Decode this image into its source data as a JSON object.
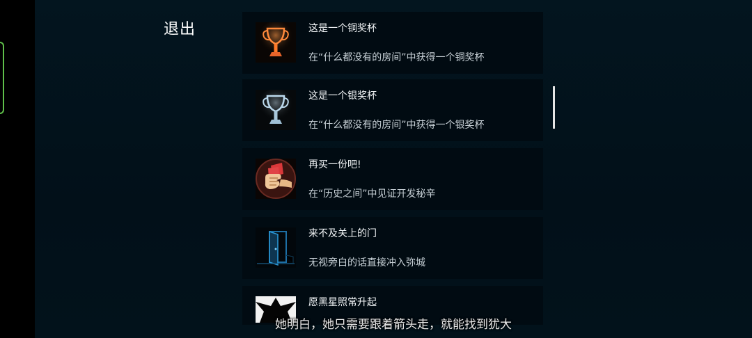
{
  "header": {
    "exit_label": "退出"
  },
  "achievements": [
    {
      "icon": "bronze-trophy-icon",
      "title": "这是一个铜奖杯",
      "desc": "在“什么都没有的房间”中获得一个铜奖杯"
    },
    {
      "icon": "silver-trophy-icon",
      "title": "这是一个银奖杯",
      "desc": "在“什么都没有的房间”中获得一个银奖杯"
    },
    {
      "icon": "money-fist-icon",
      "title": "再买一份吧!",
      "desc": "在“历史之间”中见证开发秘辛"
    },
    {
      "icon": "open-door-icon",
      "title": "来不及关上的门",
      "desc": "无视旁白的话直接冲入弥城"
    },
    {
      "icon": "black-star-icon",
      "title": "愿黑星照常升起",
      "desc": ""
    }
  ],
  "subtitle": "她明白，她只需要跟着箭头走，就能找到犹大",
  "colors": {
    "background": "#02111a",
    "card": "#010b12",
    "handle": "#5fbf4a"
  }
}
